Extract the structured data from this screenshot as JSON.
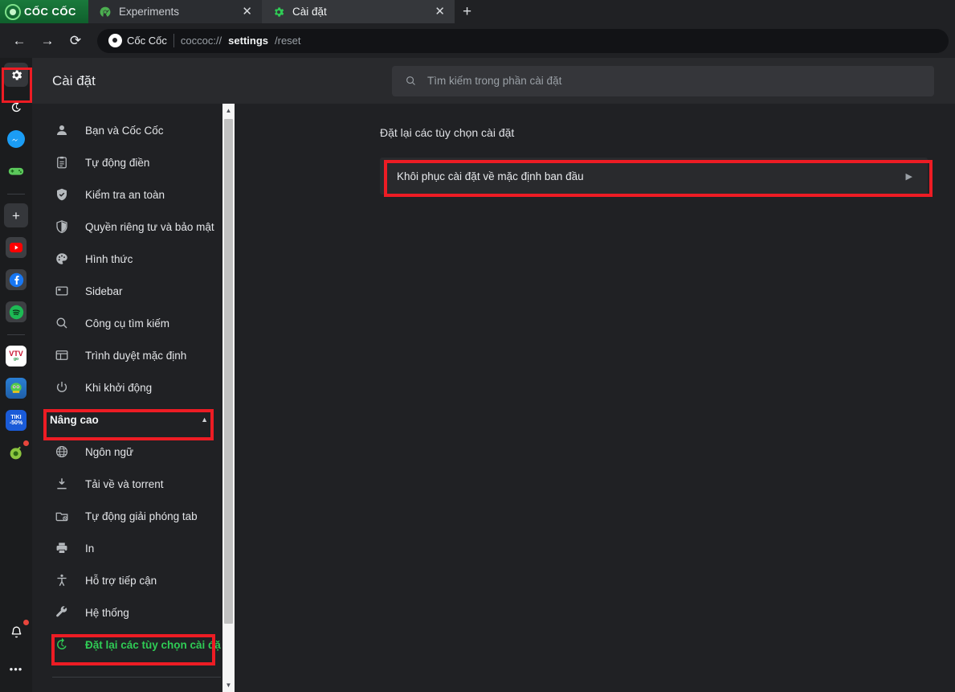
{
  "browser": {
    "brand": {
      "name": "CỐC CỐC",
      "icon": "coccoc-logo-icon"
    },
    "tabs": [
      {
        "title": "Experiments",
        "icon": "radioactive-icon",
        "close": "✕",
        "active": false
      },
      {
        "title": "Cài đặt",
        "icon": "gear-icon",
        "close": "✕",
        "active": true
      }
    ],
    "new_tab_label": "+",
    "toolbar": {
      "back": "←",
      "forward": "→",
      "reload": "⟳",
      "site_chip": "Cốc Cốc",
      "url_prefix": "coccoc://",
      "url_strong": "settings",
      "url_suffix": "/reset"
    }
  },
  "rail": {
    "items": [
      {
        "name": "settings-gear",
        "glyph": "⚙",
        "boxed": true
      },
      {
        "name": "history",
        "glyph": "↺",
        "boxed": false
      },
      {
        "name": "messenger",
        "glyph": "",
        "boxed": false
      },
      {
        "name": "games",
        "glyph": "",
        "boxed": false
      },
      {
        "name": "add-shortcut",
        "glyph": "+",
        "boxed": true
      },
      {
        "name": "youtube",
        "glyph": "",
        "boxed": false
      },
      {
        "name": "facebook",
        "glyph": "f",
        "boxed": false
      },
      {
        "name": "spotify",
        "glyph": "",
        "boxed": false
      },
      {
        "name": "vtv-go",
        "glyph": "VTV",
        "boxed": false
      },
      {
        "name": "game-tile",
        "glyph": "",
        "boxed": false
      },
      {
        "name": "tiki",
        "glyph": "TIKI -50%",
        "boxed": false
      },
      {
        "name": "coccoc-extension",
        "glyph": "",
        "boxed": false
      }
    ],
    "notifications_glyph": "🔔",
    "more_glyph": "•••"
  },
  "settings": {
    "title": "Cài đặt",
    "search_placeholder": "Tìm kiếm trong phần cài đặt",
    "search_icon": "search-icon",
    "nav": [
      {
        "label": "Bạn và Cốc Cốc",
        "icon": "person-icon"
      },
      {
        "label": "Tự động điền",
        "icon": "clipboard-icon"
      },
      {
        "label": "Kiểm tra an toàn",
        "icon": "shield-check-icon"
      },
      {
        "label": "Quyền riêng tư và bảo mật",
        "icon": "shield-icon"
      },
      {
        "label": "Hình thức",
        "icon": "palette-icon"
      },
      {
        "label": "Sidebar",
        "icon": "sidebar-icon"
      },
      {
        "label": "Công cụ tìm kiếm",
        "icon": "search-icon"
      },
      {
        "label": "Trình duyệt mặc định",
        "icon": "browser-window-icon"
      },
      {
        "label": "Khi khởi động",
        "icon": "power-icon"
      }
    ],
    "advanced_group": {
      "label": "Nâng cao",
      "chevron": "▲",
      "expanded": true
    },
    "advanced_items": [
      {
        "label": "Ngôn ngữ",
        "icon": "globe-icon",
        "selected": false
      },
      {
        "label": "Tải về và torrent",
        "icon": "download-icon",
        "selected": false
      },
      {
        "label": "Tự động giải phóng tab",
        "icon": "tab-release-icon",
        "selected": false
      },
      {
        "label": "In",
        "icon": "printer-icon",
        "selected": false
      },
      {
        "label": "Hỗ trợ tiếp cận",
        "icon": "accessibility-icon",
        "selected": false
      },
      {
        "label": "Hệ thống",
        "icon": "wrench-icon",
        "selected": false
      },
      {
        "label": "Đặt lại các tùy chọn cài đặt",
        "icon": "reset-clock-icon",
        "selected": true
      }
    ],
    "content": {
      "heading": "Đặt lại các tùy chọn cài đặt",
      "reset_row_label": "Khôi phục cài đặt về mặc định ban đầu",
      "reset_row_chevron": "▶"
    },
    "scrollbar": {
      "up": "▲",
      "down": "▼"
    }
  },
  "annotations": {
    "accent_red": "#ed1c24",
    "selected_green": "#2fcb55",
    "boxes": [
      "rail-gear",
      "reset-card",
      "nang-cao-group",
      "reset-nav-item"
    ]
  }
}
